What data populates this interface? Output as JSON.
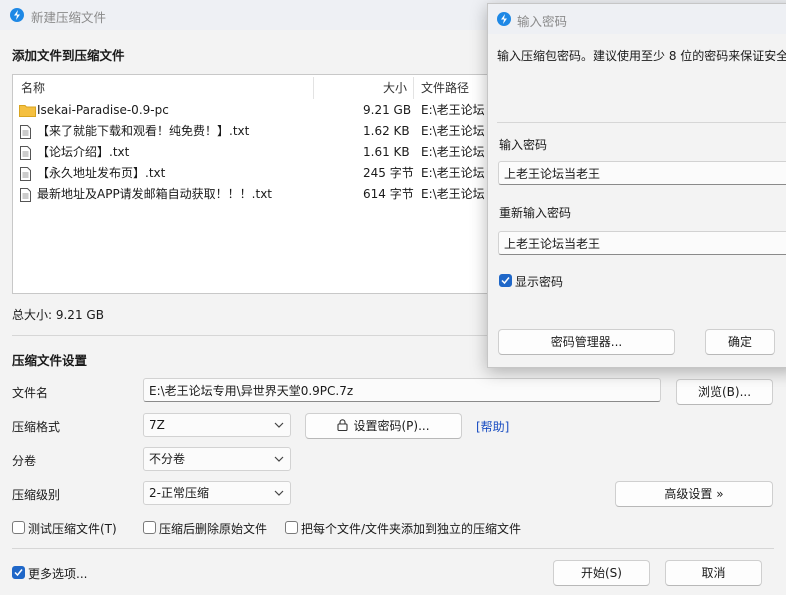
{
  "main_window": {
    "title": "新建压缩文件",
    "add_files_section": "添加文件到压缩文件",
    "columns": {
      "name": "名称",
      "size": "大小",
      "path": "文件路径"
    },
    "files": [
      {
        "name": "Isekai-Paradise-0.9-pc",
        "size": "9.21 GB",
        "path": "E:\\老王论坛",
        "type": "folder"
      },
      {
        "name": "【来了就能下载和观看！纯免费！】.txt",
        "size": "1.62 KB",
        "path": "E:\\老王论坛",
        "type": "file"
      },
      {
        "name": "【论坛介绍】.txt",
        "size": "1.61 KB",
        "path": "E:\\老王论坛",
        "type": "file"
      },
      {
        "name": "【永久地址发布页】.txt",
        "size": "245 字节",
        "path": "E:\\老王论坛",
        "type": "file"
      },
      {
        "name": "最新地址及APP请发邮箱自动获取！！！.txt",
        "size": "614 字节",
        "path": "E:\\老王论坛",
        "type": "file"
      }
    ],
    "total_size": "总大小: 9.21 GB",
    "settings_section": "压缩文件设置",
    "filename": {
      "label": "文件名",
      "value": "E:\\老王论坛专用\\异世界天堂0.9PC.7z",
      "browse_label": "浏览(B)..."
    },
    "format": {
      "label": "压缩格式",
      "value": "7Z",
      "set_password_label": "设置密码(P)...",
      "help_label": "[帮助]"
    },
    "split": {
      "label": "分卷",
      "value": "不分卷"
    },
    "level": {
      "label": "压缩级别",
      "value": "2-正常压缩",
      "advanced_label": "高级设置 »"
    },
    "options": [
      {
        "label": "测试压缩文件(T)",
        "checked": false
      },
      {
        "label": "压缩后删除原始文件",
        "checked": false
      },
      {
        "label": "把每个文件/文件夹添加到独立的压缩文件",
        "checked": false
      }
    ],
    "more_options": {
      "label": "更多选项...",
      "checked": true
    },
    "start_label": "开始(S)",
    "cancel_label": "取消"
  },
  "password_dialog": {
    "title": "输入密码",
    "description": "输入压缩包密码。建议使用至少 8 位的密码来保证安全",
    "password_label": "输入密码",
    "password_value": "上老王论坛当老王",
    "confirm_label": "重新输入密码",
    "confirm_value": "上老王论坛当老王",
    "show_password": {
      "label": "显示密码",
      "checked": true
    },
    "manager_label": "密码管理器...",
    "ok_label": "确定"
  },
  "colors": {
    "accent": "#1f67c8",
    "app_icon": "#1e88e5",
    "folder": "#f5c040",
    "link": "#1a4ec2"
  }
}
